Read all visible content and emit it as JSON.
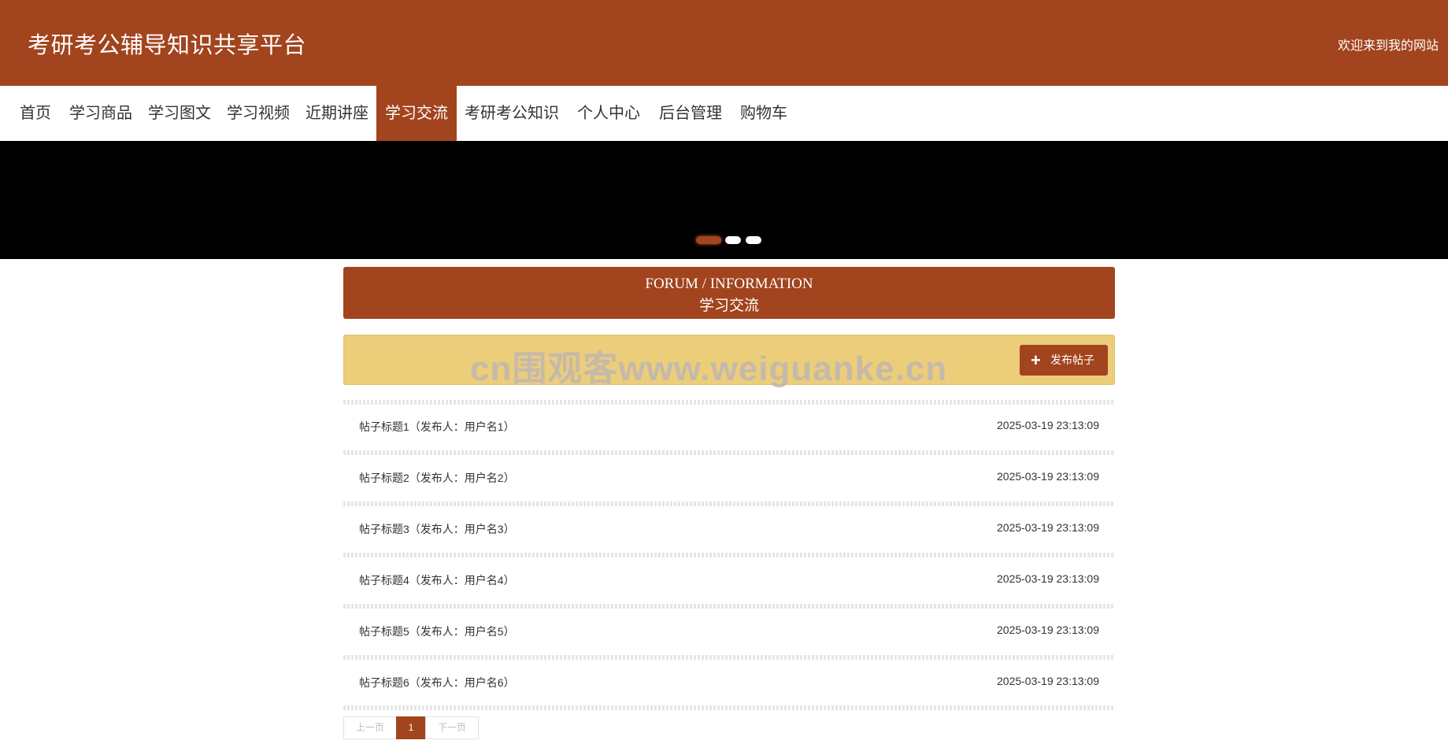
{
  "header": {
    "site_title": "考研考公辅导知识共享平台",
    "welcome": "欢迎来到我的网站"
  },
  "nav": {
    "items": [
      {
        "label": "首页"
      },
      {
        "label": "学习商品"
      },
      {
        "label": "学习图文"
      },
      {
        "label": "学习视频"
      },
      {
        "label": "近期讲座"
      },
      {
        "label": "学习交流",
        "active": true
      },
      {
        "label": "考研考公知识"
      },
      {
        "label": "个人中心"
      },
      {
        "label": "后台管理"
      },
      {
        "label": "购物车"
      }
    ]
  },
  "banner": {
    "slides": 3,
    "active_slide": 1
  },
  "section": {
    "title_en": "FORUM / INFORMATION",
    "title_cn": "学习交流"
  },
  "actionbar": {
    "watermark": "cn围观客www.weiguanke.cn",
    "post_button": "发布帖子",
    "post_icon": "plus-icon"
  },
  "posts": [
    {
      "title": "帖子标题1（发布人：用户名1）",
      "time": "2025-03-19 23:13:09"
    },
    {
      "title": "帖子标题2（发布人：用户名2）",
      "time": "2025-03-19 23:13:09"
    },
    {
      "title": "帖子标题3（发布人：用户名3）",
      "time": "2025-03-19 23:13:09"
    },
    {
      "title": "帖子标题4（发布人：用户名4）",
      "time": "2025-03-19 23:13:09"
    },
    {
      "title": "帖子标题5（发布人：用户名5）",
      "time": "2025-03-19 23:13:09"
    },
    {
      "title": "帖子标题6（发布人：用户名6）",
      "time": "2025-03-19 23:13:09"
    }
  ],
  "pagination": {
    "prev": "上一页",
    "current": "1",
    "next": "下一页"
  },
  "colors": {
    "brand": "#a2441d",
    "actionbar": "#ebcd7a"
  }
}
